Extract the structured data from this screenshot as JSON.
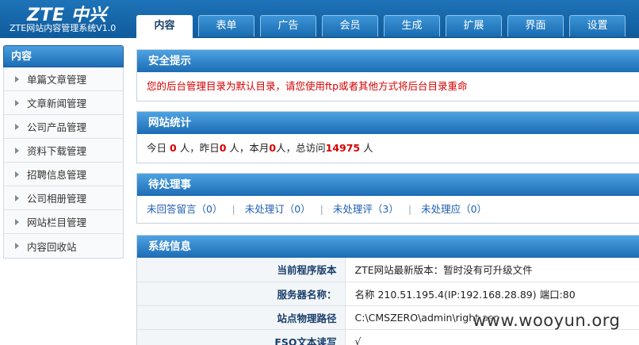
{
  "header": {
    "logo_text": "ZTE 中兴",
    "subtitle": "ZTE网站内容管理系统V1.0",
    "tabs": [
      "内容",
      "表单",
      "广告",
      "会员",
      "生成",
      "扩展",
      "界面",
      "设置"
    ],
    "active_tab": "内容"
  },
  "sidebar": {
    "title": "内容",
    "items": [
      "单篇文章管理",
      "文章新闻管理",
      "公司产品管理",
      "资料下载管理",
      "招聘信息管理",
      "公司相册管理",
      "网站栏目管理",
      "内容回收站"
    ]
  },
  "security": {
    "title": "安全提示",
    "message": "您的后台管理目录为默认目录，请您使用ftp或者其他方式将后台目录重命"
  },
  "stats": {
    "title": "网站统计",
    "today_label": "今日",
    "today": "0",
    "yesterday_label": "人，昨日",
    "yesterday": "0",
    "month_label": "人，本月",
    "month": "0",
    "total_label": "人，总访问",
    "total": "14975",
    "suffix": "人"
  },
  "todo": {
    "title": "待处理事",
    "items": [
      "未回答留言（0）",
      "未处理订（0）",
      "未处理评（3）",
      "未处理应（0）"
    ]
  },
  "sysinfo": {
    "title": "系统信息",
    "rows": [
      {
        "key": "当前程序版本",
        "value": "ZTE网站最新版本：暂时没有可升级文件"
      },
      {
        "key": "服务器名称：",
        "value": "名称 210.51.195.4(IP:192.168.28.89) 端口:80"
      },
      {
        "key": "站点物理路径",
        "value": "C:\\CMSZERO\\admin\\right.asp"
      },
      {
        "key": "FSO文本读写",
        "value": "√"
      }
    ]
  },
  "watermark": "www.wooyun.org"
}
